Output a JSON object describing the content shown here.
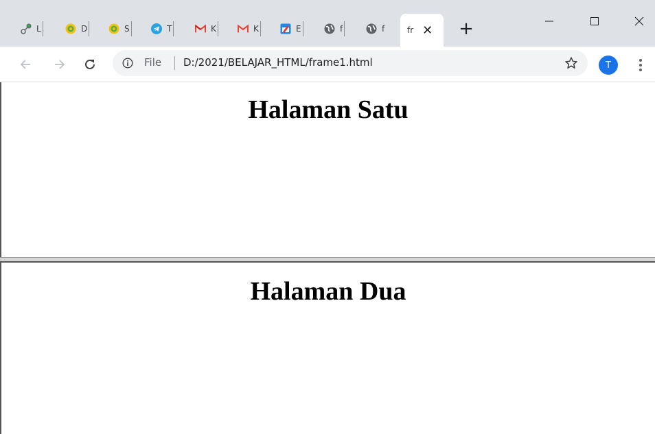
{
  "tabs": [
    {
      "label": "L",
      "icon": "link-icon"
    },
    {
      "label": "D",
      "icon": "university-seal-icon"
    },
    {
      "label": "S",
      "icon": "university-seal-icon"
    },
    {
      "label": "T",
      "icon": "telegram-icon"
    },
    {
      "label": "K",
      "icon": "gmail-icon"
    },
    {
      "label": "K",
      "icon": "gmail-icon"
    },
    {
      "label": "E",
      "icon": "edit-doc-icon"
    },
    {
      "label": "f",
      "icon": "globe-icon"
    },
    {
      "label": "f",
      "icon": "globe-icon"
    },
    {
      "label": "fr",
      "icon": "",
      "active": true
    }
  ],
  "window_controls": {
    "minimize": "minimize-icon",
    "maximize": "maximize-icon",
    "close": "close-icon"
  },
  "address_bar": {
    "scheme_label": "File",
    "url": "D:/2021/BELAJAR_HTML/frame1.html"
  },
  "profile": {
    "initial": "T",
    "color": "#1a73e8"
  },
  "frames": {
    "top": {
      "heading": "Halaman Satu"
    },
    "bottom": {
      "heading": "Halaman Dua"
    }
  }
}
